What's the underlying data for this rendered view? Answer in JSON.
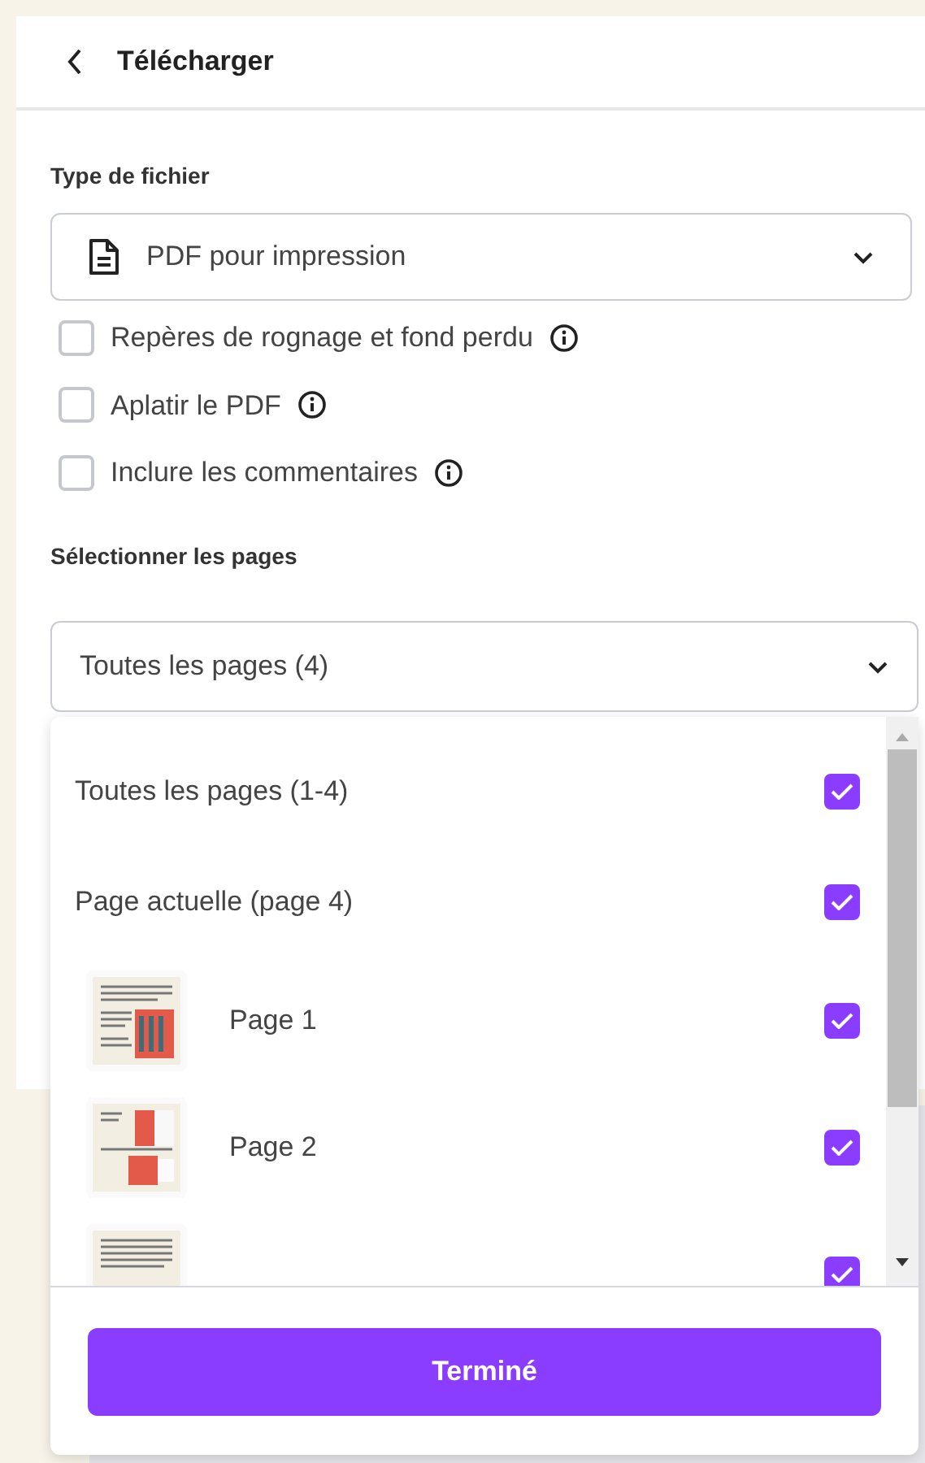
{
  "header": {
    "title": "Télécharger"
  },
  "file_type": {
    "label": "Type de fichier",
    "value": "PDF pour impression"
  },
  "options": [
    {
      "label": "Repères de rognage et fond perdu",
      "checked": false
    },
    {
      "label": "Aplatir le PDF",
      "checked": false
    },
    {
      "label": "Inclure les commentaires",
      "checked": false
    }
  ],
  "pages": {
    "label": "Sélectionner les pages",
    "value": "Toutes les pages (4)"
  },
  "page_menu": {
    "items": [
      {
        "kind": "range",
        "label": "Toutes les pages (1-4)",
        "checked": true
      },
      {
        "kind": "range",
        "label": "Page actuelle (page 4)",
        "checked": true
      },
      {
        "kind": "page",
        "label": "Page 1",
        "checked": true
      },
      {
        "kind": "page",
        "label": "Page 2",
        "checked": true
      },
      {
        "kind": "page",
        "checked": true
      }
    ],
    "done_button": "Terminé"
  }
}
